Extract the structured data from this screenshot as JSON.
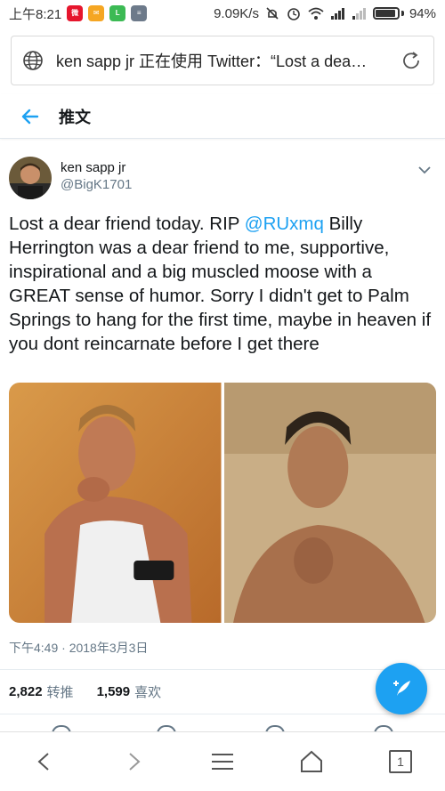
{
  "status_bar": {
    "time": "上午8:21",
    "net_speed": "9.09K/s",
    "battery_text": "94%",
    "battery_level": 0.94,
    "icons": [
      "weibo-icon",
      "mail-icon",
      "green-app-icon",
      "message-icon",
      "mute-icon",
      "alarm-icon",
      "wifi-icon",
      "signal-icon",
      "signal-icon-2",
      "battery-icon"
    ]
  },
  "browser": {
    "url_title": "ken sapp jr 正在使用 Twitter：“Lost a dea…",
    "tab_count": "1"
  },
  "page_header": {
    "title": "推文"
  },
  "tweet": {
    "author_name": "ken sapp jr",
    "author_handle": "@BigK1701",
    "text_before": "Lost a dear friend today. RIP ",
    "mention": "@RUxmq",
    "text_after": " Billy Herrington was a dear friend to me, supportive, inspirational and a big muscled moose with a GREAT sense of humor.  Sorry I didn't get to Palm Springs to hang for the first time, maybe in heaven if you dont reincarnate before I get there",
    "timestamp": "下午4:49 · 2018年3月3日",
    "retweets_count": "2,822",
    "retweets_label": "转推",
    "likes_count": "1,599",
    "likes_label": "喜欢"
  },
  "colors": {
    "accent": "#1da1f2",
    "text": "#14171a",
    "secondary": "#657786"
  }
}
